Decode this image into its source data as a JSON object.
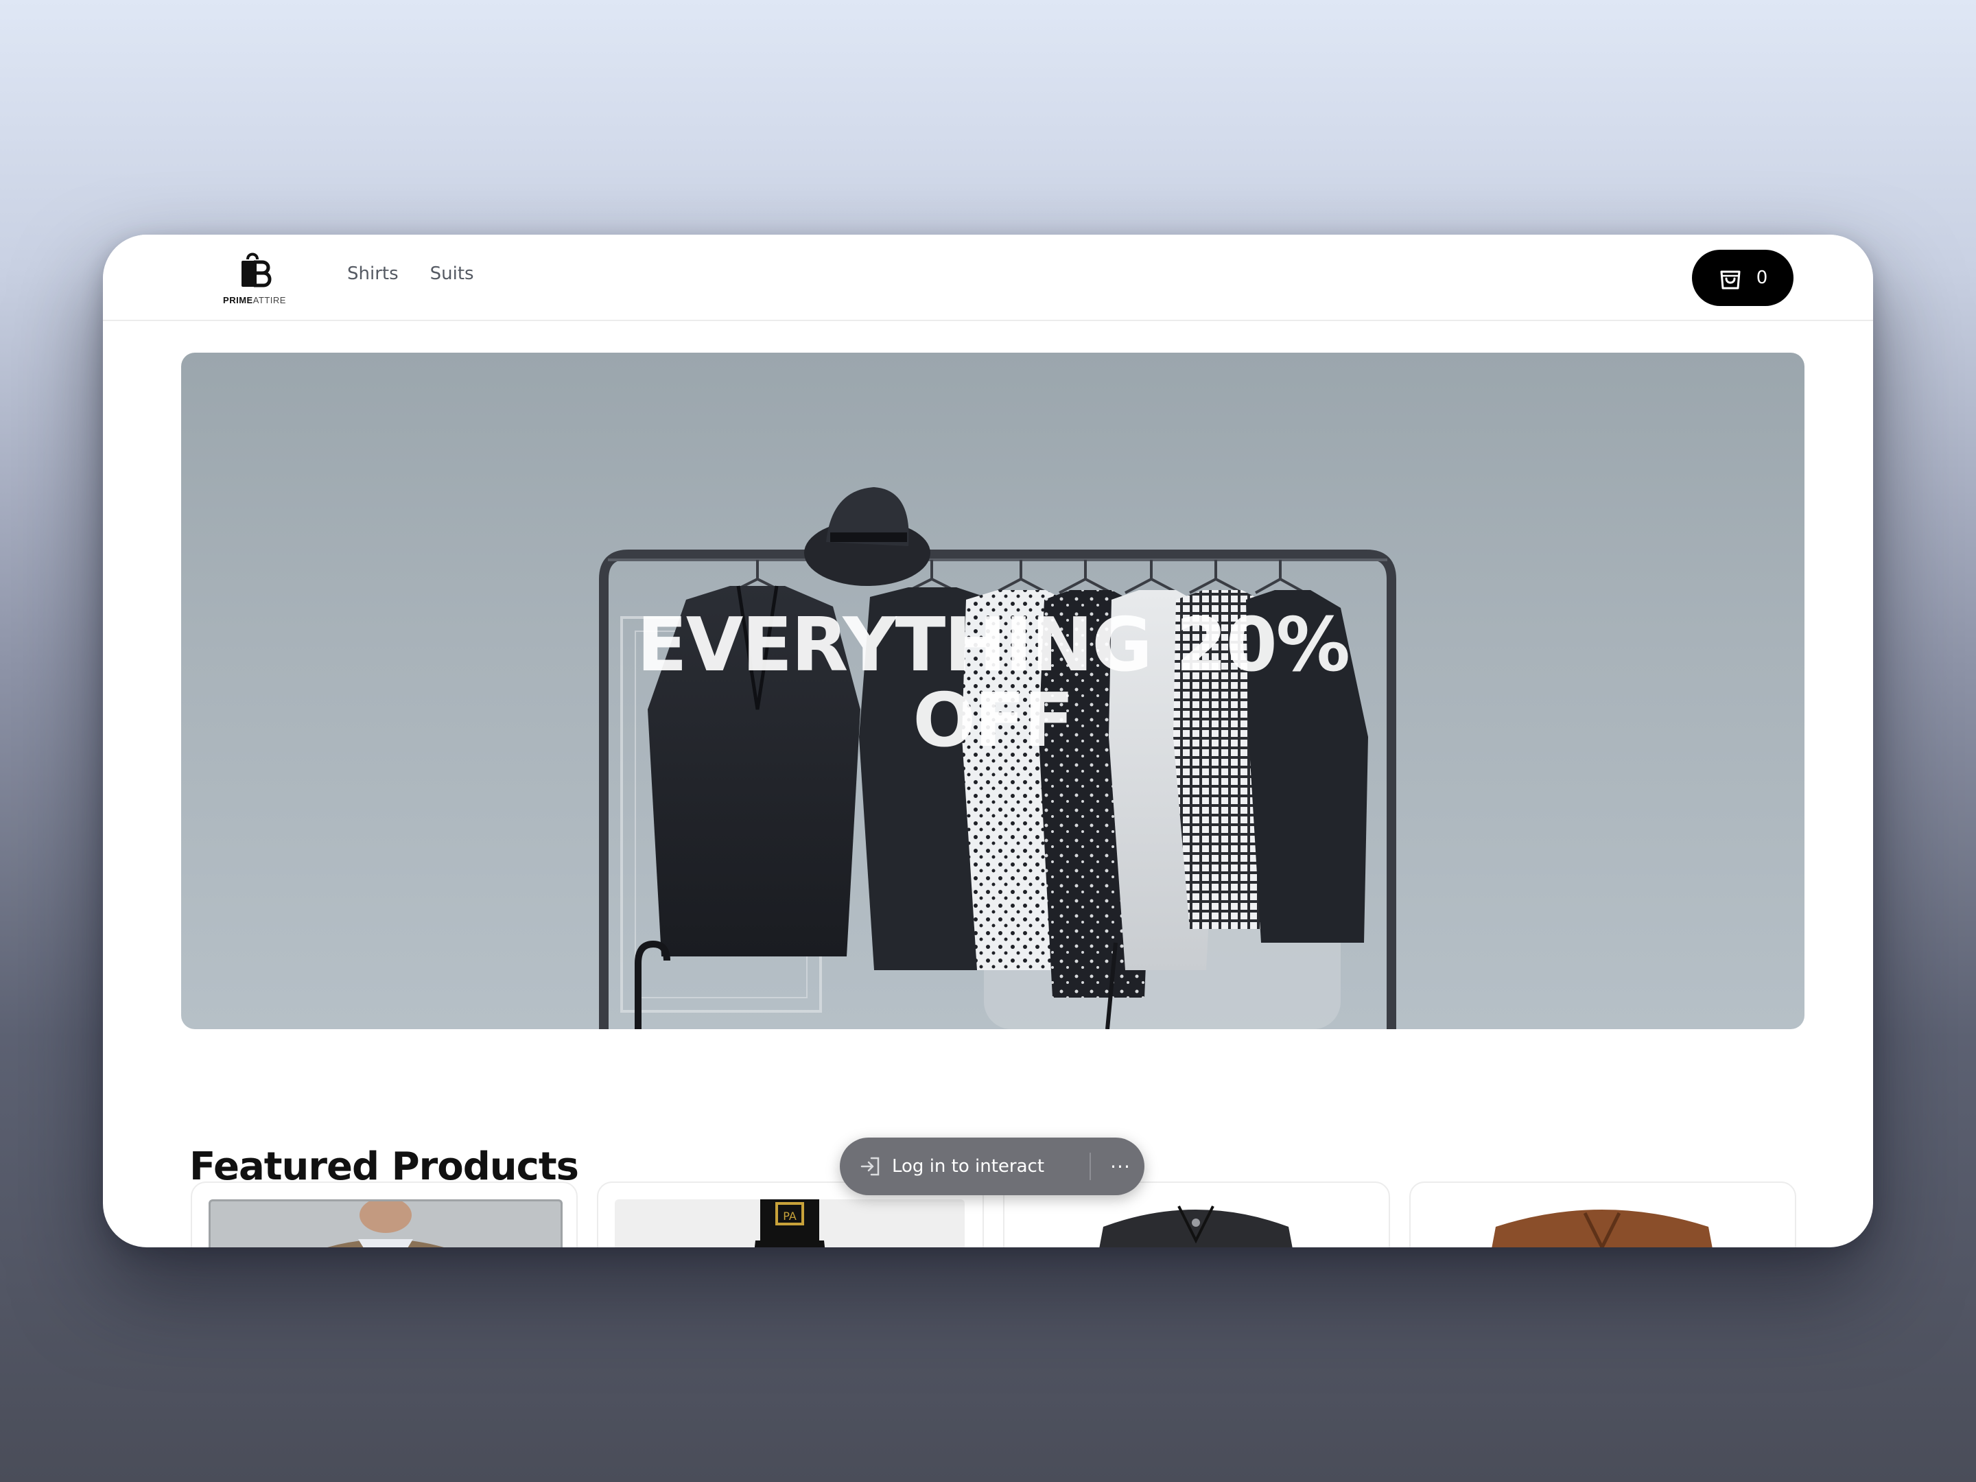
{
  "brand": {
    "logo_strong": "PRIME",
    "logo_light": "ATTIRE"
  },
  "nav": {
    "items": [
      {
        "label": "Shirts"
      },
      {
        "label": "Suits"
      }
    ]
  },
  "cart": {
    "count": "0",
    "icon": "shopping-bag-icon"
  },
  "hero": {
    "headline_line1": "EVERYTHING 20%",
    "headline_line2": "OFF"
  },
  "featured": {
    "title": "Featured Products"
  },
  "overlay": {
    "login_label": "Log in to interact",
    "more_label": "···",
    "login_icon": "login-arrow-icon"
  },
  "colors": {
    "accent": "#000000",
    "progress": "#4a90e2",
    "hero_bg": "#a3adb4"
  }
}
